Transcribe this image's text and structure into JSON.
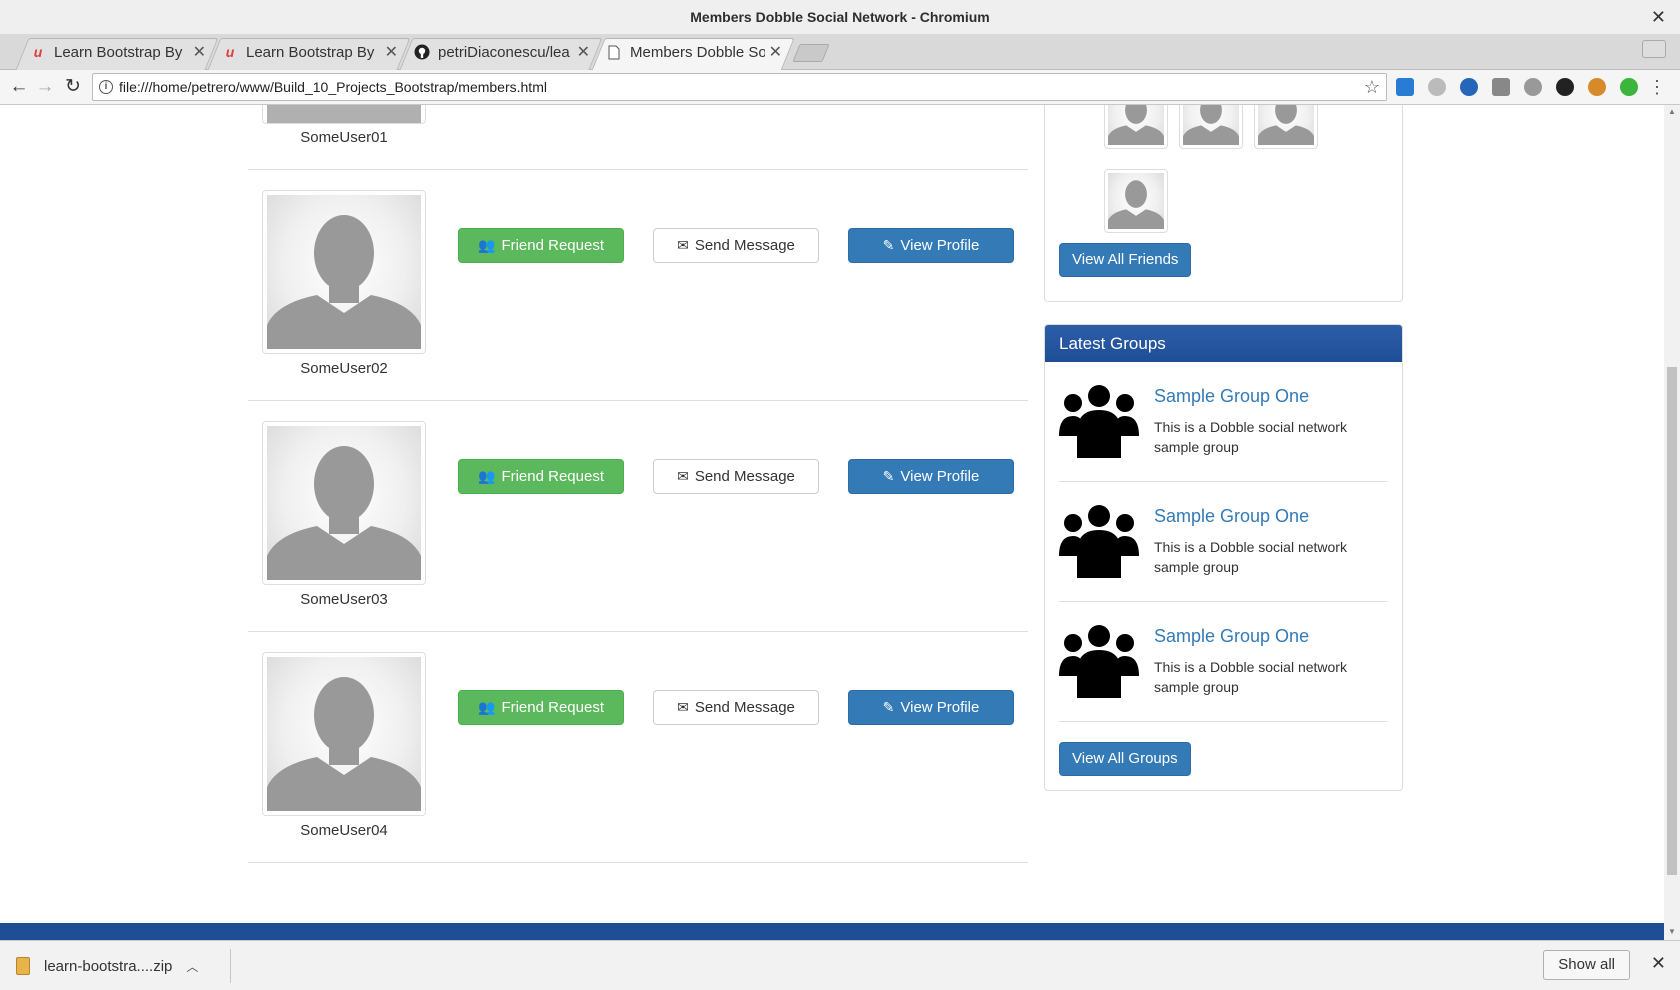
{
  "window": {
    "title": "Members Dobble Social Network - Chromium"
  },
  "tabs": [
    {
      "label": "Learn Bootstrap By",
      "icon": "udemy-icon"
    },
    {
      "label": "Learn Bootstrap By",
      "icon": "udemy-icon"
    },
    {
      "label": "petriDiaconescu/lea",
      "icon": "github-icon"
    },
    {
      "label": "Members Dobble So",
      "icon": "page-icon"
    }
  ],
  "address_bar": {
    "url": "file:///home/petrero/www/Build_10_Projects_Bootstrap/members.html"
  },
  "members": [
    {
      "username": "SomeUser01"
    },
    {
      "username": "SomeUser02"
    },
    {
      "username": "SomeUser03"
    },
    {
      "username": "SomeUser04"
    }
  ],
  "member_actions": {
    "friend_request": "Friend Request",
    "send_message": "Send Message",
    "view_profile": "View Profile"
  },
  "friends_panel": {
    "view_all_label": "View All Friends"
  },
  "groups_panel": {
    "heading": "Latest Groups",
    "items": [
      {
        "title": "Sample Group One",
        "description": "This is a Dobble social network sample group"
      },
      {
        "title": "Sample Group One",
        "description": "This is a Dobble social network sample group"
      },
      {
        "title": "Sample Group One",
        "description": "This is a Dobble social network sample group"
      }
    ],
    "view_all_label": "View All Groups"
  },
  "download_shelf": {
    "filename": "learn-bootstra....zip",
    "show_all_label": "Show all"
  },
  "colors": {
    "brand_blue": "#337ab7",
    "success_green": "#5cb85c",
    "header_blue": "#1f4e96"
  }
}
